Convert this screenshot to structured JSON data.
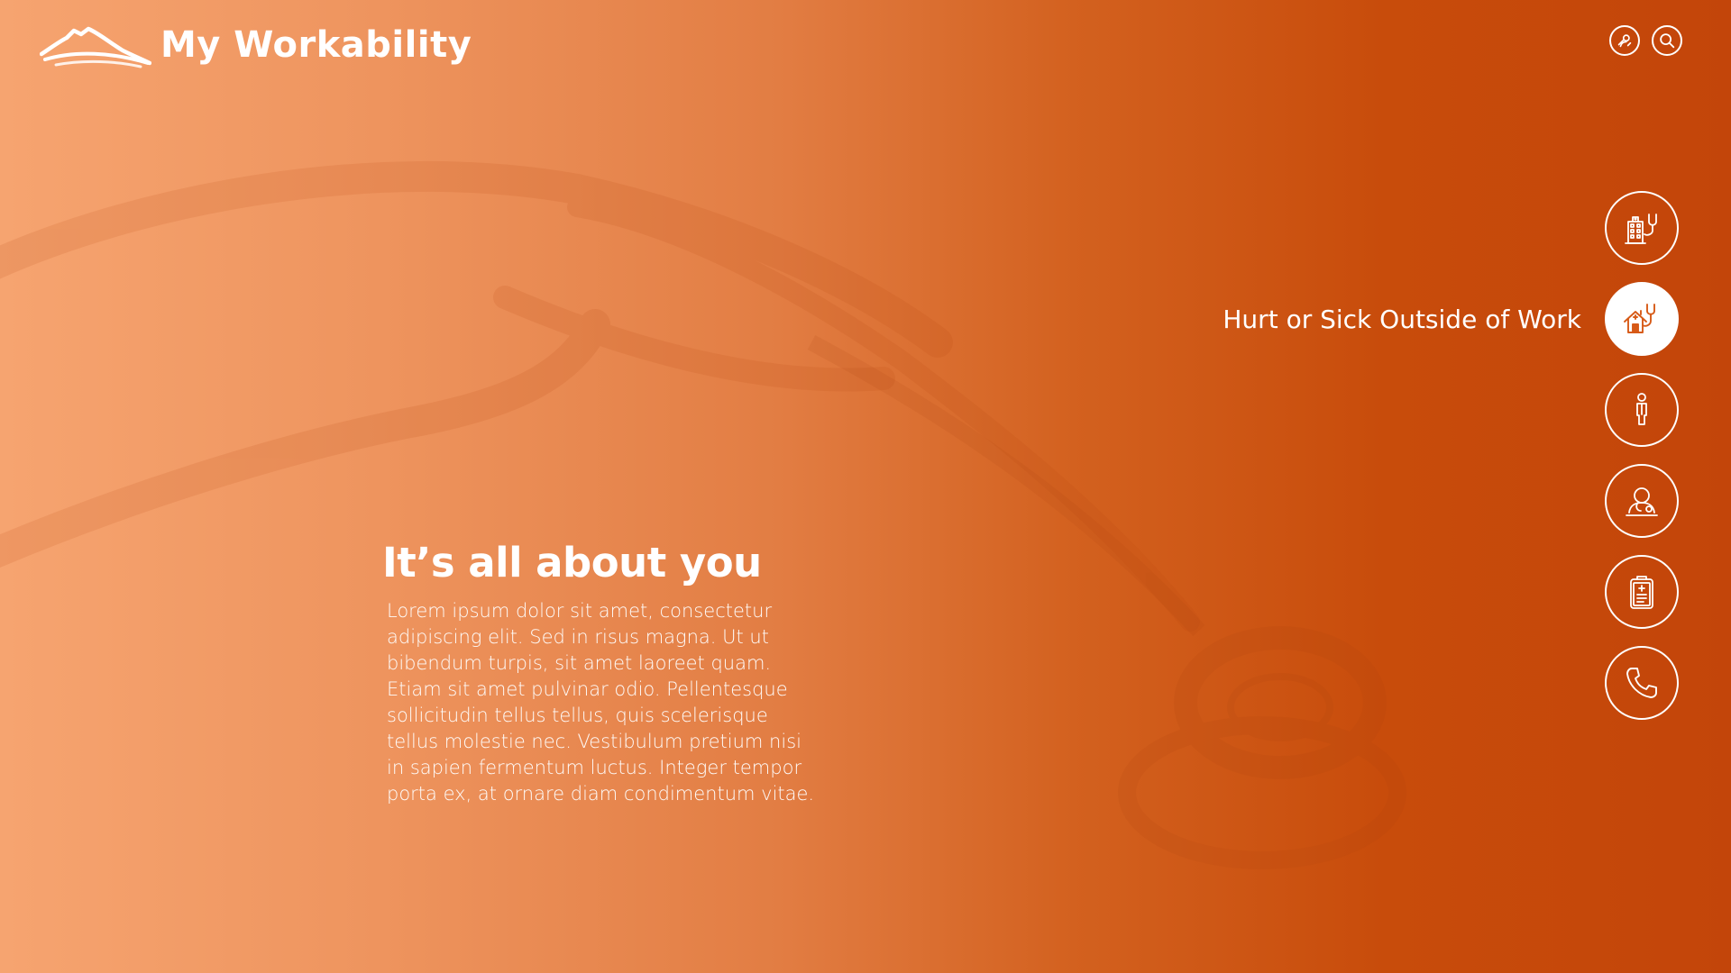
{
  "app": {
    "name": "My Workability"
  },
  "header": {
    "actions": [
      {
        "icon": "profile-link-icon"
      },
      {
        "icon": "search-icon"
      }
    ]
  },
  "hero": {
    "title": "It’s all about you",
    "body": "Lorem ipsum dolor sit amet, consectetur adipiscing elit. Sed in risus magna. Ut ut bibendum turpis, sit amet laoreet quam. Etiam sit amet pulvinar odio. Pellentesque sollicitudin tellus tellus, quis scelerisque tellus molestie nec. Vestibulum pretium nisi in sapien fermentum luctus. Integer tempor porta ex, at ornare diam condimentum vitae."
  },
  "side_nav": {
    "items": [
      {
        "icon": "hospital-stethoscope-icon",
        "label": "",
        "active": false
      },
      {
        "icon": "house-stethoscope-icon",
        "label": "Hurt or Sick Outside of Work",
        "active": true
      },
      {
        "icon": "person-icon",
        "label": "",
        "active": false
      },
      {
        "icon": "doctor-consult-icon",
        "label": "",
        "active": false
      },
      {
        "icon": "clipboard-medical-icon",
        "label": "",
        "active": false
      },
      {
        "icon": "phone-icon",
        "label": "",
        "active": false
      }
    ]
  },
  "colors": {
    "gradient_left": "#f6a470",
    "gradient_right": "#c3450a",
    "active_icon": "#d75a17",
    "text": "#ffffff"
  }
}
